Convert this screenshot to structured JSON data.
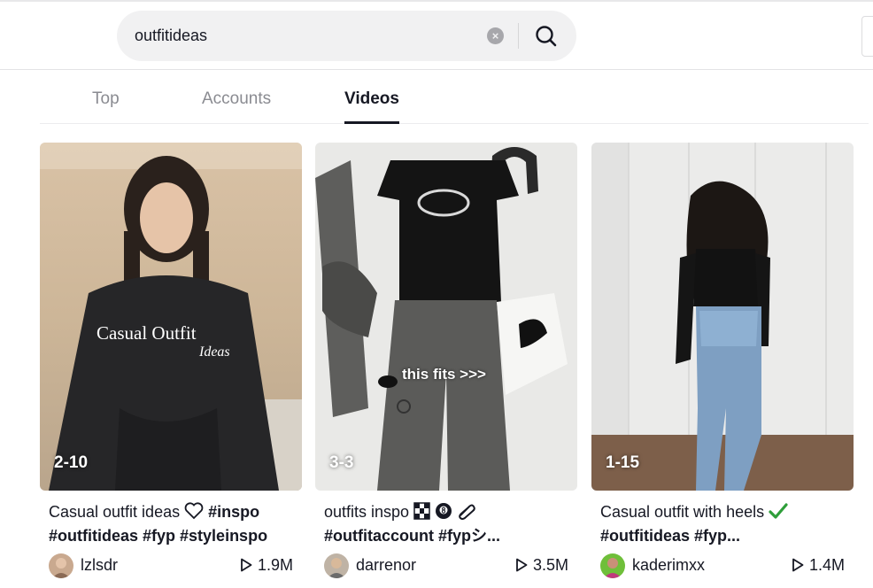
{
  "search": {
    "value": "outfitideas",
    "clear_icon": "×"
  },
  "tabs": [
    {
      "label": "Top",
      "active": false
    },
    {
      "label": "Accounts",
      "active": false
    },
    {
      "label": "Videos",
      "active": true
    }
  ],
  "videos": [
    {
      "badge": "2-10",
      "overlay_title": "Casual Outfit",
      "overlay_subtitle": "Ideas",
      "desc_text": "Casual outfit ideas ",
      "desc_icon": "heart-outline-icon",
      "tags_line1": "#inspo",
      "tags_line2": "#outfitideas #fyp #styleinspo",
      "username": "lzlsdr",
      "views": "1.9M"
    },
    {
      "badge": "3-3",
      "overlay_caption": "this fits >>>",
      "desc_text": "outfits inspo ",
      "desc_emojis": [
        "checker-icon",
        "8-ball-icon",
        "paperclip-icon"
      ],
      "tags_line2": "#outfitaccount #fypシ...",
      "username": "darrenor",
      "views": "3.5M"
    },
    {
      "badge": "1-15",
      "desc_text": "Casual outfit with heels ",
      "desc_icon": "check-mark-icon",
      "tags_line2": "#outfitideas #fyp...",
      "username": "kaderimxx",
      "views": "1.4M"
    }
  ],
  "colors": {
    "text": "#161823",
    "muted": "#8a8b91",
    "check": "#2e9e3a"
  }
}
